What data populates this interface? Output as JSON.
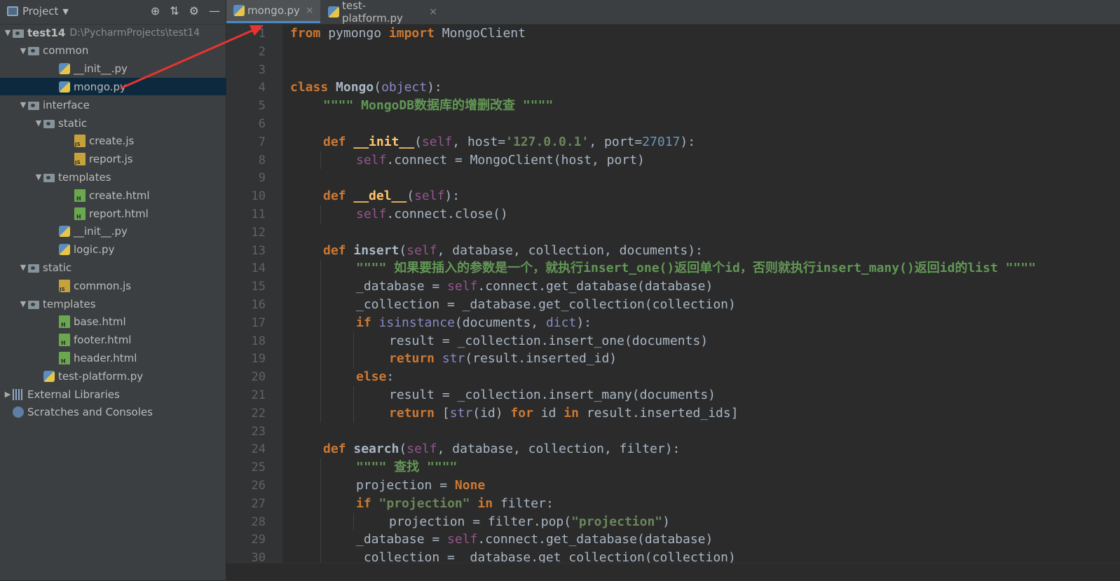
{
  "project_panel": {
    "title": "Project",
    "tree": [
      {
        "label": "test14",
        "path": "D:\\PycharmProjects\\test14",
        "icon": "folder-icon",
        "arrow": "▼",
        "level": 0,
        "bold": true
      },
      {
        "label": "common",
        "icon": "folder-icon",
        "arrow": "▼",
        "level": 1
      },
      {
        "label": "__init__.py",
        "icon": "python-file-icon",
        "arrow": "",
        "level": 3
      },
      {
        "label": "mongo.py",
        "icon": "python-file-icon",
        "arrow": "",
        "level": 3,
        "selected": true
      },
      {
        "label": "interface",
        "icon": "folder-icon",
        "arrow": "▼",
        "level": 1
      },
      {
        "label": "static",
        "icon": "folder-icon",
        "arrow": "▼",
        "level": 2
      },
      {
        "label": "create.js",
        "icon": "js-file-icon",
        "arrow": "",
        "level": 4
      },
      {
        "label": "report.js",
        "icon": "js-file-icon",
        "arrow": "",
        "level": 4
      },
      {
        "label": "templates",
        "icon": "folder-icon",
        "arrow": "▼",
        "level": 2
      },
      {
        "label": "create.html",
        "icon": "html-file-icon",
        "arrow": "",
        "level": 4
      },
      {
        "label": "report.html",
        "icon": "html-file-icon",
        "arrow": "",
        "level": 4
      },
      {
        "label": "__init__.py",
        "icon": "python-file-icon",
        "arrow": "",
        "level": 3
      },
      {
        "label": "logic.py",
        "icon": "python-file-icon",
        "arrow": "",
        "level": 3
      },
      {
        "label": "static",
        "icon": "folder-icon",
        "arrow": "▼",
        "level": 1
      },
      {
        "label": "common.js",
        "icon": "js-file-icon",
        "arrow": "",
        "level": 3
      },
      {
        "label": "templates",
        "icon": "folder-icon",
        "arrow": "▼",
        "level": 1
      },
      {
        "label": "base.html",
        "icon": "html-file-icon",
        "arrow": "",
        "level": 3
      },
      {
        "label": "footer.html",
        "icon": "html-file-icon",
        "arrow": "",
        "level": 3
      },
      {
        "label": "header.html",
        "icon": "html-file-icon",
        "arrow": "",
        "level": 3
      },
      {
        "label": "test-platform.py",
        "icon": "python-file-icon",
        "arrow": "",
        "level": 2
      },
      {
        "label": "External Libraries",
        "icon": "library-icon",
        "arrow": "▶",
        "level": 0
      },
      {
        "label": "Scratches and Consoles",
        "icon": "scratches-icon",
        "arrow": "",
        "level": 0
      }
    ]
  },
  "tabs": [
    {
      "label": "mongo.py",
      "active": true
    },
    {
      "label": "test-platform.py",
      "active": false
    }
  ],
  "colors": {
    "keyword": "#cc7832",
    "keyword_bold": "#cc7832",
    "string": "#6a8759",
    "self": "#94558d",
    "builtin": "#8888c6",
    "number": "#6897bb",
    "plain": "#a9b7c6",
    "docstring": "#629755",
    "fn": "#ffc66d"
  },
  "code_lines": [
    {
      "n": "1",
      "indent": 0,
      "tokens": [
        [
          "kw",
          "from"
        ],
        [
          "p",
          " pymongo "
        ],
        [
          "kw",
          "import"
        ],
        [
          "p",
          " MongoClient"
        ]
      ]
    },
    {
      "n": "2",
      "indent": 0,
      "tokens": []
    },
    {
      "n": "3",
      "indent": 0,
      "tokens": []
    },
    {
      "n": "4",
      "indent": 0,
      "tokens": [
        [
          "kw",
          "class"
        ],
        [
          "p",
          " "
        ],
        [
          "bd",
          "Mongo"
        ],
        [
          "p",
          "("
        ],
        [
          "bi",
          "object"
        ],
        [
          "p",
          "):"
        ]
      ]
    },
    {
      "n": "5",
      "indent": 1,
      "tokens": [
        [
          "doc",
          "\"\"\"\" MongoDB数据库的增删改查 \"\"\"\""
        ]
      ]
    },
    {
      "n": "6",
      "indent": 0,
      "tokens": []
    },
    {
      "n": "7",
      "indent": 1,
      "tokens": [
        [
          "kw",
          "def"
        ],
        [
          "p",
          " "
        ],
        [
          "fn",
          "__init__"
        ],
        [
          "p",
          "("
        ],
        [
          "self",
          "self"
        ],
        [
          "p",
          ", host="
        ],
        [
          "str",
          "'127.0.0.1'"
        ],
        [
          "p",
          ", port="
        ],
        [
          "num",
          "27017"
        ],
        [
          "p",
          "):"
        ]
      ]
    },
    {
      "n": "8",
      "indent": 2,
      "tokens": [
        [
          "self",
          "self"
        ],
        [
          "p",
          ".connect = MongoClient(host, port)"
        ]
      ]
    },
    {
      "n": "9",
      "indent": 0,
      "tokens": []
    },
    {
      "n": "10",
      "indent": 1,
      "tokens": [
        [
          "kw",
          "def"
        ],
        [
          "p",
          " "
        ],
        [
          "fn",
          "__del__"
        ],
        [
          "p",
          "("
        ],
        [
          "self",
          "self"
        ],
        [
          "p",
          "):"
        ]
      ]
    },
    {
      "n": "11",
      "indent": 2,
      "tokens": [
        [
          "self",
          "self"
        ],
        [
          "p",
          ".connect.close()"
        ]
      ]
    },
    {
      "n": "12",
      "indent": 0,
      "tokens": []
    },
    {
      "n": "13",
      "indent": 1,
      "tokens": [
        [
          "kw",
          "def"
        ],
        [
          "p",
          " "
        ],
        [
          "bd",
          "insert"
        ],
        [
          "p",
          "("
        ],
        [
          "self",
          "self"
        ],
        [
          "p",
          ", database, collection, documents):"
        ]
      ]
    },
    {
      "n": "14",
      "indent": 2,
      "tokens": [
        [
          "doc",
          "\"\"\"\" 如果要插入的参数是一个，就执行insert_one()返回单个id，否则就执行insert_many()返回id的list \"\"\"\""
        ]
      ]
    },
    {
      "n": "15",
      "indent": 2,
      "tokens": [
        [
          "p",
          "_database = "
        ],
        [
          "self",
          "self"
        ],
        [
          "p",
          ".connect.get_database(database)"
        ]
      ]
    },
    {
      "n": "16",
      "indent": 2,
      "tokens": [
        [
          "p",
          "_collection = _database.get_collection(collection)"
        ]
      ]
    },
    {
      "n": "17",
      "indent": 2,
      "tokens": [
        [
          "kw",
          "if"
        ],
        [
          "p",
          " "
        ],
        [
          "bi",
          "isinstance"
        ],
        [
          "p",
          "(documents, "
        ],
        [
          "bi",
          "dict"
        ],
        [
          "p",
          "):"
        ]
      ]
    },
    {
      "n": "18",
      "indent": 3,
      "tokens": [
        [
          "p",
          "result = _collection.insert_one(documents)"
        ]
      ]
    },
    {
      "n": "19",
      "indent": 3,
      "tokens": [
        [
          "kw",
          "return"
        ],
        [
          "p",
          " "
        ],
        [
          "bi",
          "str"
        ],
        [
          "p",
          "(result.inserted_id)"
        ]
      ]
    },
    {
      "n": "20",
      "indent": 2,
      "tokens": [
        [
          "kw",
          "else"
        ],
        [
          "p",
          ":"
        ]
      ]
    },
    {
      "n": "21",
      "indent": 3,
      "tokens": [
        [
          "p",
          "result = _collection.insert_many(documents)"
        ]
      ]
    },
    {
      "n": "22",
      "indent": 3,
      "tokens": [
        [
          "kw",
          "return"
        ],
        [
          "p",
          " ["
        ],
        [
          "bi",
          "str"
        ],
        [
          "p",
          "(id) "
        ],
        [
          "kw",
          "for"
        ],
        [
          "p",
          " id "
        ],
        [
          "kw",
          "in"
        ],
        [
          "p",
          " result.inserted_ids]"
        ]
      ]
    },
    {
      "n": "23",
      "indent": 0,
      "tokens": []
    },
    {
      "n": "24",
      "indent": 1,
      "tokens": [
        [
          "kw",
          "def"
        ],
        [
          "p",
          " "
        ],
        [
          "bd",
          "search"
        ],
        [
          "p",
          "("
        ],
        [
          "self",
          "self"
        ],
        [
          "p",
          ", database, collection, filter):"
        ]
      ]
    },
    {
      "n": "25",
      "indent": 2,
      "tokens": [
        [
          "doc",
          "\"\"\"\" 查找 \"\"\"\""
        ]
      ]
    },
    {
      "n": "26",
      "indent": 2,
      "tokens": [
        [
          "p",
          "projection = "
        ],
        [
          "kw",
          "None"
        ]
      ]
    },
    {
      "n": "27",
      "indent": 2,
      "tokens": [
        [
          "kw",
          "if"
        ],
        [
          "p",
          " "
        ],
        [
          "str",
          "\"projection\""
        ],
        [
          "p",
          " "
        ],
        [
          "kw",
          "in"
        ],
        [
          "p",
          " filter:"
        ]
      ]
    },
    {
      "n": "28",
      "indent": 3,
      "tokens": [
        [
          "p",
          "projection = filter.pop("
        ],
        [
          "str",
          "\"projection\""
        ],
        [
          "p",
          ")"
        ]
      ]
    },
    {
      "n": "29",
      "indent": 2,
      "tokens": [
        [
          "p",
          "_database = "
        ],
        [
          "self",
          "self"
        ],
        [
          "p",
          ".connect.get_database(database)"
        ]
      ]
    },
    {
      "n": "30",
      "indent": 2,
      "tokens": [
        [
          "p",
          "_collection = _database.get_collection(collection)"
        ]
      ]
    }
  ]
}
